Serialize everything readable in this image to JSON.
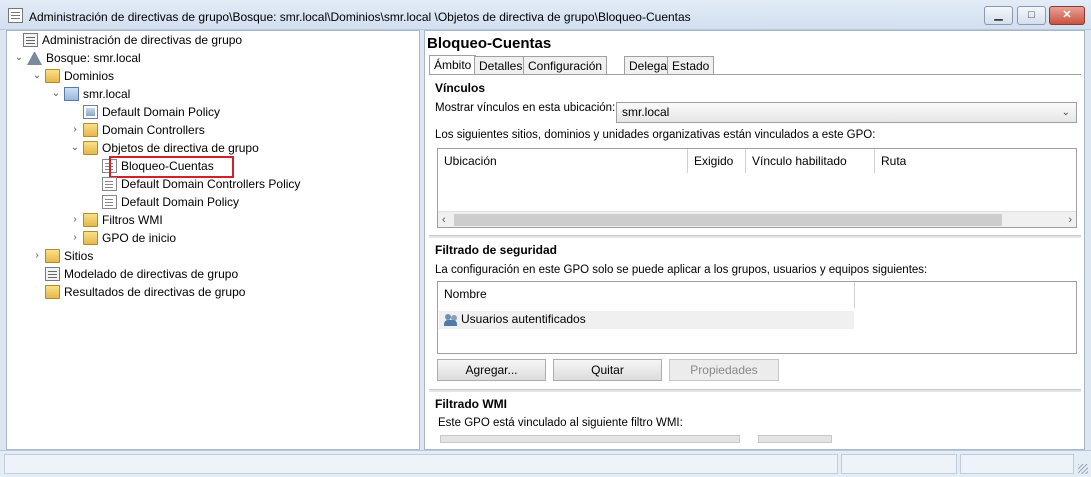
{
  "window": {
    "title": "Administración de directivas de grupo\\Bosque: smr.local\\Dominios\\smr.local \\Objetos de directiva de grupo\\Bloqueo-Cuentas",
    "controls": {
      "minimize": "▁",
      "maximize": "□",
      "close": "✕"
    }
  },
  "tree": {
    "items": [
      {
        "label": "Administración de directivas de grupo",
        "icon": "console-icon",
        "expander": ""
      },
      {
        "label": "Bosque: smr.local",
        "icon": "forest-icon",
        "expander": "⌄"
      },
      {
        "label": "Dominios",
        "icon": "folder-icon",
        "expander": "⌄"
      },
      {
        "label": "smr.local",
        "icon": "domain-icon",
        "expander": "⌄"
      },
      {
        "label": "Default Domain Policy",
        "icon": "gpo-link-icon",
        "expander": ""
      },
      {
        "label": "Domain Controllers",
        "icon": "ou-folder-icon",
        "expander": "›"
      },
      {
        "label": "Objetos de directiva de grupo",
        "icon": "folder-icon",
        "expander": "⌄"
      },
      {
        "label": "Bloqueo-Cuentas",
        "icon": "gpo-icon",
        "expander": "",
        "selected": true
      },
      {
        "label": "Default Domain Controllers Policy",
        "icon": "gpo-icon",
        "expander": ""
      },
      {
        "label": "Default Domain Policy",
        "icon": "gpo-icon",
        "expander": ""
      },
      {
        "label": "Filtros WMI",
        "icon": "folder-icon",
        "expander": "›"
      },
      {
        "label": "GPO de inicio",
        "icon": "folder-icon",
        "expander": "›"
      },
      {
        "label": "Sitios",
        "icon": "sites-icon",
        "expander": "›"
      },
      {
        "label": "Modelado de directivas de grupo",
        "icon": "modeling-icon",
        "expander": ""
      },
      {
        "label": "Resultados de directivas de grupo",
        "icon": "results-icon",
        "expander": ""
      }
    ]
  },
  "details": {
    "title": "Bloqueo-Cuentas",
    "tabs": [
      "Ámbito",
      "Detalles",
      "Configuración",
      "Delegación",
      "Estado"
    ],
    "active_tab": "Ámbito",
    "links": {
      "heading": "Vínculos",
      "show_label": "Mostrar vínculos en esta ubicación:",
      "location_value": "smr.local",
      "description": "Los siguientes sitios, dominios y unidades organizativas están vinculados a este GPO:",
      "columns": [
        "Ubicación",
        "Exigido",
        "Vínculo habilitado",
        "Ruta"
      ],
      "scroll_left": "‹",
      "scroll_right": "›"
    },
    "security": {
      "heading": "Filtrado de seguridad",
      "description": "La configuración en este GPO solo se puede aplicar a los grupos, usuarios y equipos siguientes:",
      "column": "Nombre",
      "rows": [
        "Usuarios autentificados"
      ],
      "buttons": {
        "add": "Agregar...",
        "remove": "Quitar",
        "properties": "Propiedades"
      }
    },
    "wmi": {
      "heading": "Filtrado WMI",
      "description": "Este GPO está vinculado al siguiente filtro WMI:"
    }
  }
}
